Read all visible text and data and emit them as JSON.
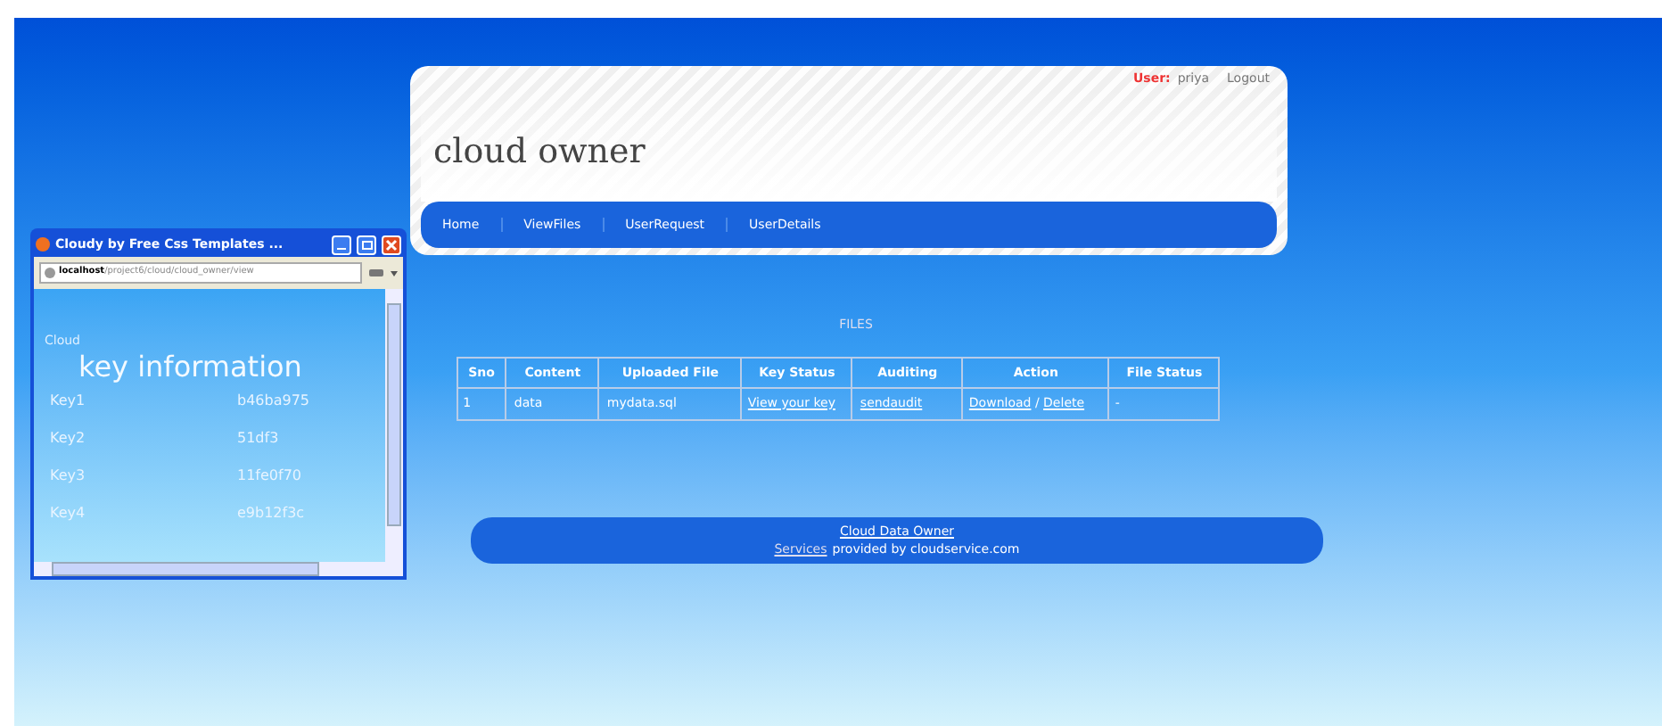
{
  "header": {
    "user_label": "User:",
    "user_name": "priya",
    "logout": "Logout",
    "title": "cloud owner"
  },
  "nav": [
    {
      "label": "Home"
    },
    {
      "label": "ViewFiles"
    },
    {
      "label": "UserRequest"
    },
    {
      "label": "UserDetails"
    }
  ],
  "files": {
    "heading": "FILES",
    "columns": [
      "Sno",
      "Content",
      "Uploaded File",
      "Key Status",
      "Auditing",
      "Action",
      "File Status"
    ],
    "rows": [
      {
        "sno": "1",
        "content": "data",
        "file": "mydata.sql",
        "key_status": "View your key",
        "auditing": "sendaudit",
        "download": "Download",
        "separator": "/",
        "delete": "Delete",
        "file_status": "-"
      }
    ]
  },
  "footer": {
    "link": "Cloud Data Owner",
    "services": "Services",
    "rest": "provided by cloudservice.com"
  },
  "popup": {
    "title": "Cloudy by Free Css Templates ...",
    "url_host": "localhost",
    "url_path": "/project6/cloud/cloud_owner/view",
    "small_heading": "Cloud",
    "heading": "key information",
    "keys": [
      {
        "name": "Key1",
        "value": "b46ba975"
      },
      {
        "name": "Key2",
        "value": "51df3"
      },
      {
        "name": "Key3",
        "value": "11fe0f70"
      },
      {
        "name": "Key4",
        "value": "e9b12f3c"
      }
    ]
  }
}
